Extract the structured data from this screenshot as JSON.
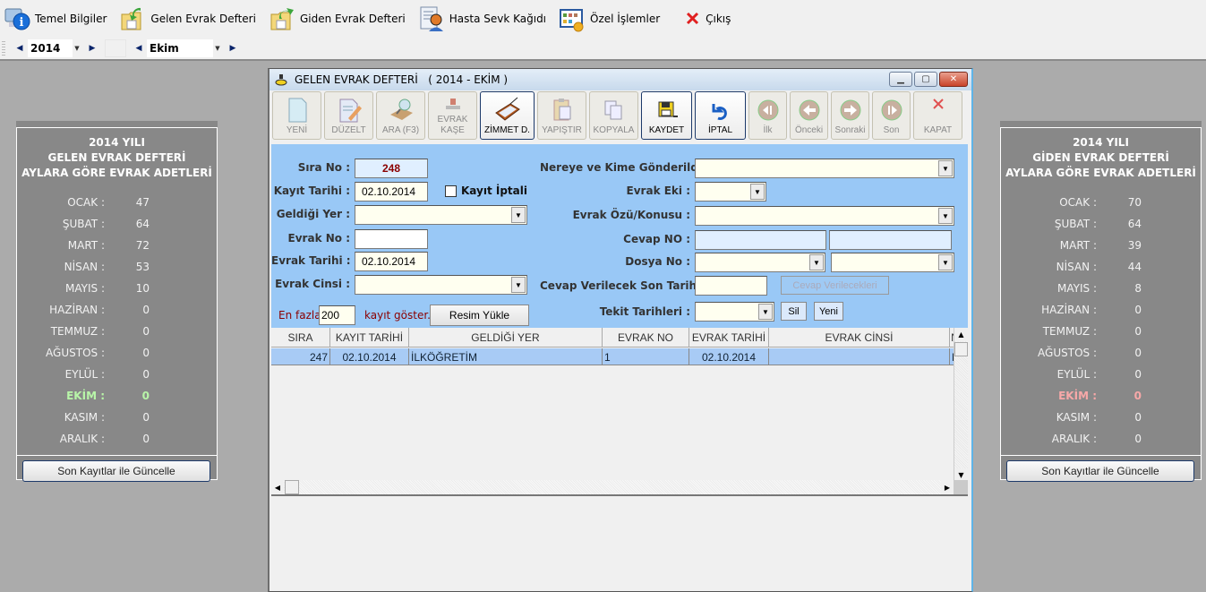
{
  "menu": [
    {
      "label": "Temel Bilgiler",
      "icon": "info-computer-icon"
    },
    {
      "label": "Gelen Evrak Defteri",
      "icon": "incoming-folder-icon"
    },
    {
      "label": "Giden Evrak Defteri",
      "icon": "outgoing-folder-icon"
    },
    {
      "label": "Hasta Sevk Kağıdı",
      "icon": "patient-referral-icon"
    },
    {
      "label": "Özel İşlemler",
      "icon": "special-operations-icon"
    },
    {
      "label": "Çıkış",
      "icon": "exit-icon"
    }
  ],
  "selectors": {
    "year": "2014",
    "month": "Ekim"
  },
  "left_panel": {
    "title_lines": [
      "2014 YILI",
      "GELEN EVRAK DEFTERİ",
      "AYLARA GÖRE EVRAK ADETLERİ"
    ],
    "months": [
      {
        "month": "OCAK :",
        "count": "47"
      },
      {
        "month": "ŞUBAT :",
        "count": "64"
      },
      {
        "month": "MART :",
        "count": "72"
      },
      {
        "month": "NİSAN :",
        "count": "53"
      },
      {
        "month": "MAYIS :",
        "count": "10"
      },
      {
        "month": "HAZİRAN :",
        "count": "0"
      },
      {
        "month": "TEMMUZ :",
        "count": "0"
      },
      {
        "month": "AĞUSTOS :",
        "count": "0"
      },
      {
        "month": "EYLÜL :",
        "count": "0"
      },
      {
        "month": "EKİM :",
        "count": "0"
      },
      {
        "month": "KASIM :",
        "count": "0"
      },
      {
        "month": "ARALIK :",
        "count": "0"
      }
    ],
    "highlight_color": "#b8f5a8",
    "button_label": "Son Kayıtlar ile Güncelle"
  },
  "right_panel": {
    "title_lines": [
      "2014 YILI",
      "GİDEN EVRAK DEFTERİ",
      "AYLARA GÖRE EVRAK ADETLERİ"
    ],
    "months": [
      {
        "month": "OCAK :",
        "count": "70"
      },
      {
        "month": "ŞUBAT :",
        "count": "64"
      },
      {
        "month": "MART :",
        "count": "39"
      },
      {
        "month": "NİSAN :",
        "count": "44"
      },
      {
        "month": "MAYIS :",
        "count": "8"
      },
      {
        "month": "HAZİRAN :",
        "count": "0"
      },
      {
        "month": "TEMMUZ :",
        "count": "0"
      },
      {
        "month": "AĞUSTOS :",
        "count": "0"
      },
      {
        "month": "EYLÜL :",
        "count": "0"
      },
      {
        "month": "EKİM :",
        "count": "0"
      },
      {
        "month": "KASIM :",
        "count": "0"
      },
      {
        "month": "ARALIK :",
        "count": "0"
      }
    ],
    "highlight_color": "#f7a8a8",
    "button_label": "Son Kayıtlar ile Güncelle"
  },
  "window": {
    "title": "GELEN EVRAK DEFTERİ   ( 2014 - EKİM )",
    "toolbar": [
      {
        "label": "YENİ",
        "icon": "new-document-icon",
        "enabled": false
      },
      {
        "label": "DÜZELT",
        "icon": "edit-document-icon",
        "enabled": false
      },
      {
        "label": "ARA (F3)",
        "icon": "search-icon",
        "enabled": false
      },
      {
        "label": "EVRAK KAŞE",
        "icon": "stamp-icon",
        "enabled": false
      },
      {
        "label": "ZİMMET D.",
        "icon": "scanner-book-icon",
        "enabled": true
      },
      {
        "label": "YAPIŞTIR",
        "icon": "paste-icon",
        "enabled": false
      },
      {
        "label": "KOPYALA",
        "icon": "copy-icon",
        "enabled": false
      },
      {
        "label": "KAYDET",
        "icon": "save-disk-icon",
        "enabled": true
      },
      {
        "label": "İPTAL",
        "icon": "undo-icon",
        "enabled": true
      },
      {
        "label": "İlk",
        "icon": "first-record-icon",
        "enabled": false
      },
      {
        "label": "Önceki",
        "icon": "previous-record-icon",
        "enabled": false
      },
      {
        "label": "Sonraki",
        "icon": "next-record-icon",
        "enabled": false
      },
      {
        "label": "Son",
        "icon": "last-record-icon",
        "enabled": false
      },
      {
        "label": "KAPAT",
        "icon": "close-x-icon",
        "enabled": false
      }
    ],
    "form": {
      "sira_no_label": "Sıra No :",
      "sira_no_value": "248",
      "kayit_tarihi_label": "Kayıt Tarihi :",
      "kayit_tarihi_value": "02.10.2014",
      "kayit_iptali_label": "Kayıt İptali",
      "kayit_iptali_checked": false,
      "geldigi_yer_label": "Geldiği Yer :",
      "geldigi_yer_value": "",
      "evrak_no_label": "Evrak No :",
      "evrak_no_value": "",
      "evrak_tarihi_label": "Evrak Tarihi :",
      "evrak_tarihi_value": "02.10.2014",
      "evrak_cinsi_label": "Evrak Cinsi :",
      "evrak_cinsi_value": "",
      "en_fazla_label": "En fazla",
      "en_fazla_value": "200",
      "kayit_goster_label": "kayıt göster.",
      "resim_yukle_label": "Resim Yükle",
      "nereye_label": "Nereye ve Kime Gönderildi",
      "nereye_value": "",
      "evrak_eki_label": "Evrak Eki :",
      "evrak_eki_value": "",
      "evrak_ozu_label": "Evrak Özü/Konusu :",
      "evrak_ozu_value": "",
      "cevap_no_label": "Cevap NO :",
      "cevap_no_value1": "",
      "cevap_no_value2": "",
      "dosya_no_label": "Dosya No :",
      "dosya_no_value1": "",
      "dosya_no_value2": "",
      "cevap_son_tarih_label": "Cevap Verilecek Son Tarih",
      "cevap_son_tarih_value": "",
      "cevap_verilecekleri_label": "Cevap Verilecekleri",
      "tekit_label": "Tekit Tarihleri :",
      "tekit_value": "",
      "sil_label": "Sil",
      "yeni_label": "Yeni"
    },
    "grid": {
      "columns": [
        "SIRA",
        "KAYIT TARİHİ",
        "GELDİĞİ YER",
        "EVRAK NO",
        "EVRAK TARİHİ",
        "EVRAK CİNSİ",
        "N"
      ],
      "rows": [
        [
          "247",
          "02.10.2014",
          "İLKÖĞRETİM",
          "1",
          "02.10.2014",
          "",
          "KO"
        ]
      ]
    }
  }
}
